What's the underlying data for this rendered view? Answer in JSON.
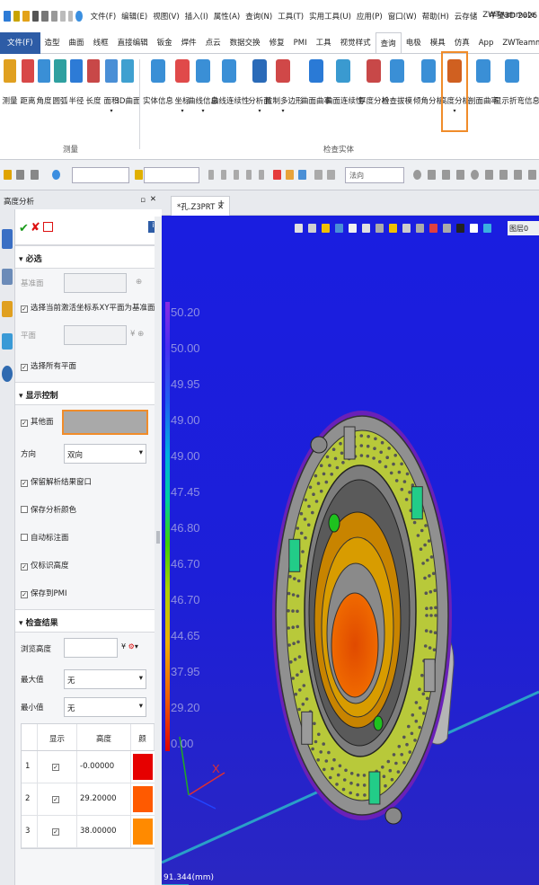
{
  "titlebar": {
    "menus": [
      "文件(F)",
      "编辑(E)",
      "视图(V)",
      "插入(I)",
      "属性(A)",
      "查询(N)",
      "工具(T)",
      "实用工具(U)",
      "应用(P)",
      "窗口(W)",
      "帮助(H)",
      "云存储",
      "ZWTeammate"
    ],
    "app_title": "中望3D 2026"
  },
  "tabs": [
    "文件(F)",
    "造型",
    "曲面",
    "线框",
    "直接编辑",
    "钣金",
    "焊件",
    "点云",
    "数据交换",
    "修复",
    "PMI",
    "工具",
    "视觉样式",
    "查询",
    "电极",
    "模具",
    "仿真",
    "App",
    "ZWTeammate"
  ],
  "active_tab": "查询",
  "ribbon": {
    "measure_group": "测量",
    "check_group": "检查实体",
    "measure_buttons": [
      "测量",
      "距离",
      "角度",
      "圆弧",
      "半径",
      "长度",
      "面积",
      "3D曲面"
    ],
    "check_buttons": [
      "实体信息",
      "坐标",
      "曲线信息",
      "曲线连续性",
      "分析面",
      "拉制多边形",
      "曲面曲率",
      "曲面连续性",
      "厚度分析",
      "检查拔模",
      "倾角分析",
      "高度分析",
      "剖面曲率",
      "显示折弯信息"
    ]
  },
  "toolbar": {
    "filter_placeholder": "法向"
  },
  "panel": {
    "title": "高度分析",
    "options_header": "必选",
    "base_face_label": "基准面",
    "use_xy_label": "选择当前激活坐标系XY平面为基准面",
    "plane_label": "平面",
    "select_all_planes_label": "选择所有平面",
    "display_header": "显示控制",
    "other_face_label": "其他面",
    "direction_label": "方向",
    "direction_value": "双向",
    "keep_result_label": "保留解析结果窗口",
    "keep_color_label": "保存分析颜色",
    "auto_mark_label": "自动标注面",
    "only_height_label": "仅标识高度",
    "save_pmi_label": "保存到PMI",
    "results_header": "检查结果",
    "browse_height_label": "浏览高度",
    "max_label": "最大值",
    "max_value": "无",
    "min_label": "最小值",
    "min_value": "无",
    "table_headers": [
      "显示",
      "高度",
      "颜"
    ],
    "table_rows": [
      {
        "index": "1",
        "height": "-0.00000",
        "color": "#e60000"
      },
      {
        "index": "2",
        "height": "29.20000",
        "color": "#ff5a00"
      },
      {
        "index": "3",
        "height": "38.00000",
        "color": "#ff8a00"
      }
    ]
  },
  "viewport": {
    "doc_tab": "*孔.Z3PRT",
    "layer_label": "图层0",
    "status": "91.344(mm)",
    "legend_values": [
      "50.20",
      "50.00",
      "49.95",
      "49.00",
      "49.00",
      "47.45",
      "46.80",
      "46.70",
      "46.70",
      "44.65",
      "37.95",
      "29.20",
      "0.00"
    ],
    "axis_x": "X"
  },
  "colors": {
    "accent": "#2d5ca6",
    "highlight": "#f08c2a",
    "viewport_bg": "#1d1fd8"
  }
}
